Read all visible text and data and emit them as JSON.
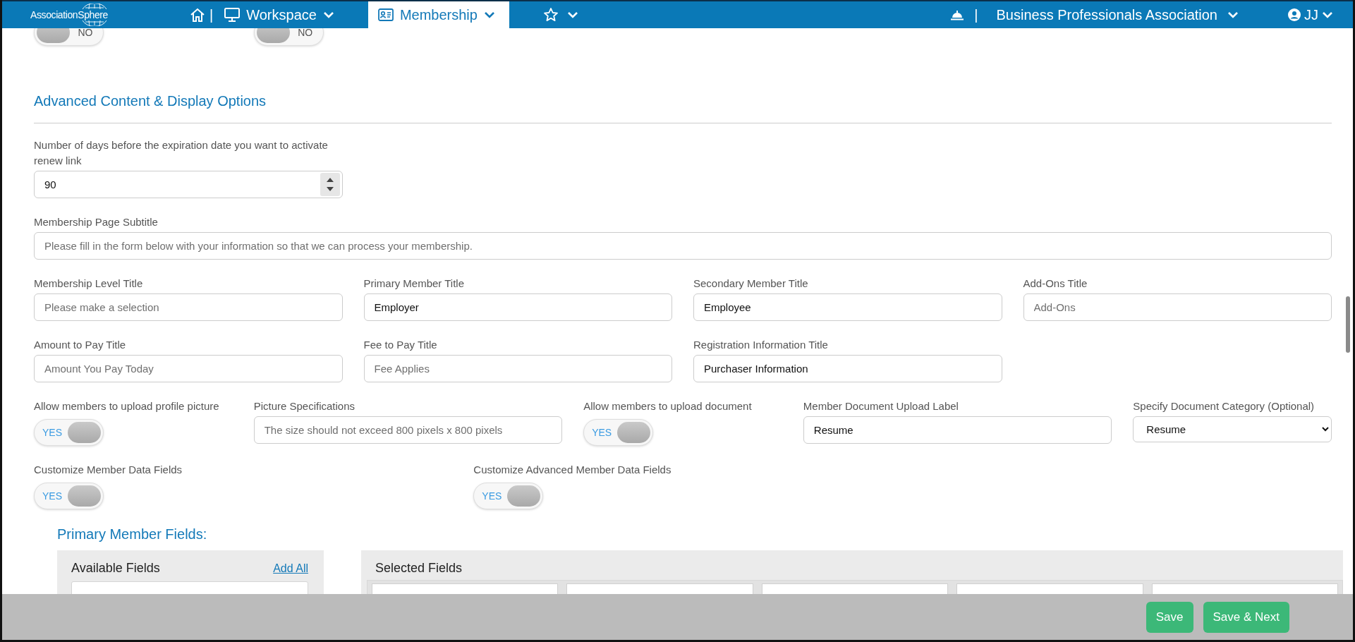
{
  "header": {
    "logo": "AssociationSphere",
    "nav": [
      {
        "kind": "home",
        "separator": "|",
        "selected": false
      },
      {
        "kind": "workspace",
        "label": "Workspace",
        "selected": false
      },
      {
        "kind": "membership",
        "label": "Membership",
        "selected": true
      },
      {
        "kind": "favorites",
        "selected": false
      }
    ],
    "notifications_separator": "|",
    "organization": "Business Professionals Association",
    "user": "JJ"
  },
  "top_toggles": [
    {
      "text": "NO",
      "on": false
    },
    {
      "text": "NO",
      "on": false
    }
  ],
  "section": {
    "title": "Advanced Content & Display Options"
  },
  "rows": [
    [
      {
        "kind": "number",
        "label": "Number of days before the expiration date you want to activate renew link",
        "value": "90"
      }
    ],
    [
      {
        "kind": "text",
        "label": "Membership Page Subtitle",
        "placeholder": "Please fill in the form below with your information so that we can process your membership."
      }
    ],
    [
      {
        "kind": "text",
        "label": "Membership Level Title",
        "placeholder": "Please make a selection"
      },
      {
        "kind": "text",
        "label": "Primary Member Title",
        "value": "Employer"
      },
      {
        "kind": "text",
        "label": "Secondary Member Title",
        "value": "Employee"
      },
      {
        "kind": "text",
        "label": "Add-Ons Title",
        "placeholder": "Add-Ons"
      }
    ],
    [
      {
        "kind": "text",
        "label": "Amount to Pay Title",
        "placeholder": "Amount You Pay Today"
      },
      {
        "kind": "text",
        "label": "Fee to Pay Title",
        "placeholder": "Fee Applies"
      },
      {
        "kind": "text",
        "label": "Registration Information Title",
        "value": "Purchaser Information"
      }
    ],
    [
      {
        "kind": "toggle",
        "label": "Allow members to upload profile picture",
        "text": "YES",
        "on": true
      },
      {
        "kind": "text",
        "label": "Picture Specifications",
        "placeholder": "The size should not exceed 800 pixels x 800 pixels"
      },
      {
        "kind": "toggle",
        "label": "Allow members to upload document",
        "text": "YES",
        "on": true
      },
      {
        "kind": "text",
        "label": "Member Document Upload Label",
        "value": "Resume"
      },
      {
        "kind": "select",
        "label": "Specify Document Category (Optional)",
        "value": "Resume"
      }
    ],
    [
      {
        "kind": "toggle",
        "label": "Customize Member Data Fields",
        "text": "YES",
        "on": true
      },
      {
        "kind": "toggle",
        "label": "Customize Advanced Member Data Fields",
        "text": "YES",
        "on": true
      }
    ]
  ],
  "primary_member_fields": {
    "title": "Primary Member Fields:",
    "available": {
      "title": "Available Fields",
      "action": "Add All"
    },
    "selected": {
      "title": "Selected Fields"
    }
  },
  "footer": {
    "buttons": [
      "Save",
      "Save & Next"
    ]
  }
}
